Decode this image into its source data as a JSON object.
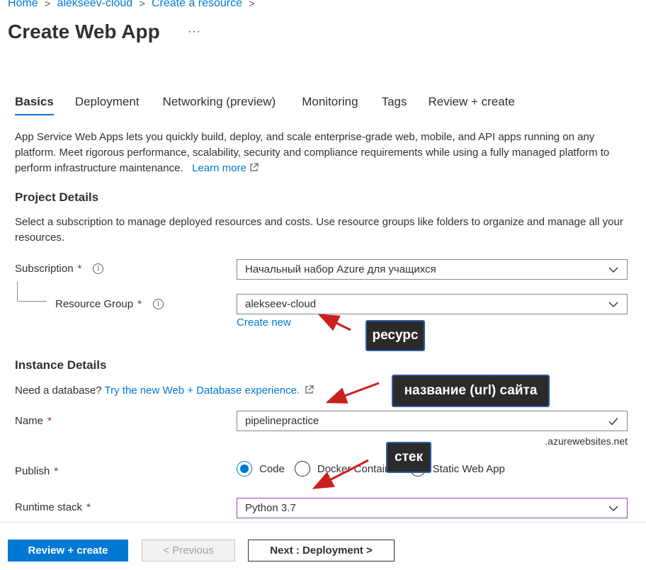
{
  "breadcrumb": {
    "items": [
      "Home",
      "alekseev-cloud",
      "Create a resource"
    ],
    "separator": ">"
  },
  "page": {
    "title": "Create Web App",
    "more": "···"
  },
  "tabs": [
    "Basics",
    "Deployment",
    "Networking (preview)",
    "Monitoring",
    "Tags",
    "Review + create"
  ],
  "active_tab": "Basics",
  "intro": {
    "text": "App Service Web Apps lets you quickly build, deploy, and scale enterprise-grade web, mobile, and API apps running on any platform. Meet rigorous performance, scalability, security and compliance requirements while using a fully managed platform to perform infrastructure maintenance.",
    "link": "Learn more"
  },
  "project_details": {
    "title": "Project Details",
    "description": "Select a subscription to manage deployed resources and costs. Use resource groups like folders to organize and manage all your resources.",
    "subscription_label": "Subscription",
    "subscription_value": "Начальный набор Azure для учащихся",
    "resource_group_label": "Resource Group",
    "resource_group_value": "alekseev-cloud",
    "create_new": "Create new",
    "required_mark": "*"
  },
  "instance_details": {
    "title": "Instance Details",
    "database_prompt": "Need a database?",
    "database_link": "Try the new Web + Database experience.",
    "name_label": "Name",
    "name_value": "pipelinepractice",
    "name_suffix": ".azurewebsites.net",
    "publish_label": "Publish",
    "publish_options": [
      "Code",
      "Docker Container",
      "Static Web App"
    ],
    "publish_selected": "Code",
    "runtime_label": "Runtime stack",
    "runtime_value": "Python 3.7"
  },
  "footer": {
    "review_create": "Review + create",
    "previous": "< Previous",
    "next": "Next : Deployment >"
  },
  "annotations": {
    "resource": "ресурс",
    "site_name": "название (url) сайта",
    "stack": "стек"
  },
  "colors": {
    "accent": "#0078d4",
    "required": "#a4262c",
    "annotation_arrow": "#cc1f1f",
    "valid_check": "#323130"
  }
}
